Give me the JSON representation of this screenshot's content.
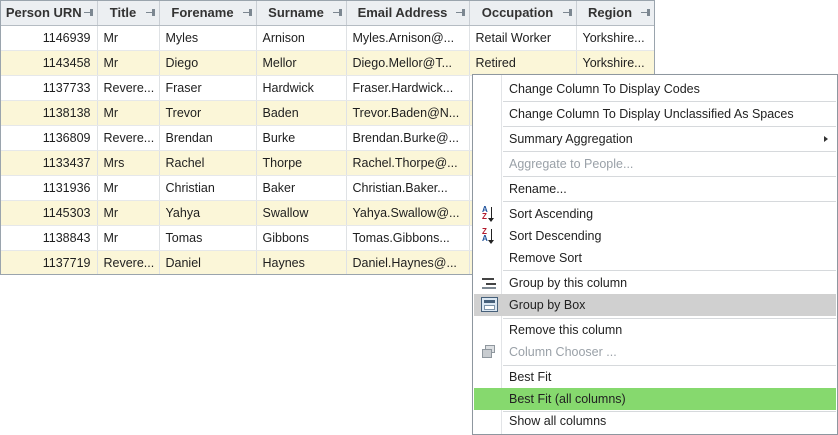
{
  "grid": {
    "columns": [
      {
        "key": "urn",
        "label": "Person URN"
      },
      {
        "key": "title",
        "label": "Title"
      },
      {
        "key": "forename",
        "label": "Forename"
      },
      {
        "key": "surname",
        "label": "Surname"
      },
      {
        "key": "email",
        "label": "Email Address"
      },
      {
        "key": "occupation",
        "label": "Occupation"
      },
      {
        "key": "region",
        "label": "Region"
      }
    ],
    "rows": [
      {
        "urn": "1146939",
        "title": "Mr",
        "forename": "Myles",
        "surname": "Arnison",
        "email": "Myles.Arnison@...",
        "occupation": "Retail Worker",
        "region": "Yorkshire..."
      },
      {
        "urn": "1143458",
        "title": "Mr",
        "forename": "Diego",
        "surname": "Mellor",
        "email": "Diego.Mellor@T...",
        "occupation": "Retired",
        "region": "Yorkshire..."
      },
      {
        "urn": "1137733",
        "title": "Revere...",
        "forename": "Fraser",
        "surname": "Hardwick",
        "email": "Fraser.Hardwick...",
        "occupation": "",
        "region": ""
      },
      {
        "urn": "1138138",
        "title": "Mr",
        "forename": "Trevor",
        "surname": "Baden",
        "email": "Trevor.Baden@N...",
        "occupation": "",
        "region": ""
      },
      {
        "urn": "1136809",
        "title": "Revere...",
        "forename": "Brendan",
        "surname": "Burke",
        "email": "Brendan.Burke@...",
        "occupation": "",
        "region": ""
      },
      {
        "urn": "1133437",
        "title": "Mrs",
        "forename": "Rachel",
        "surname": "Thorpe",
        "email": "Rachel.Thorpe@...",
        "occupation": "",
        "region": ""
      },
      {
        "urn": "1131936",
        "title": "Mr",
        "forename": "Christian",
        "surname": "Baker",
        "email": "Christian.Baker...",
        "occupation": "",
        "region": ""
      },
      {
        "urn": "1145303",
        "title": "Mr",
        "forename": "Yahya",
        "surname": "Swallow",
        "email": "Yahya.Swallow@...",
        "occupation": "",
        "region": ""
      },
      {
        "urn": "1138843",
        "title": "Mr",
        "forename": "Tomas",
        "surname": "Gibbons",
        "email": "Tomas.Gibbons...",
        "occupation": "",
        "region": ""
      },
      {
        "urn": "1137719",
        "title": "Revere...",
        "forename": "Daniel",
        "surname": "Haynes",
        "email": "Daniel.Haynes@...",
        "occupation": "",
        "region": ""
      }
    ]
  },
  "menu": {
    "items": [
      {
        "label": "Change Column To Display Codes",
        "state": "normal"
      },
      {
        "label": "Change Column To Display Unclassified As Spaces",
        "state": "normal"
      },
      {
        "label": "Summary Aggregation",
        "state": "normal",
        "submenu": true
      },
      {
        "label": "Aggregate to People...",
        "state": "disabled"
      },
      {
        "label": "Rename...",
        "state": "normal"
      },
      {
        "label": "Sort Ascending",
        "state": "normal",
        "icon": "sort-ascending-icon"
      },
      {
        "label": "Sort Descending",
        "state": "normal",
        "icon": "sort-descending-icon"
      },
      {
        "label": "Remove Sort",
        "state": "normal"
      },
      {
        "label": "Group by this column",
        "state": "normal",
        "icon": "group-by-column-icon"
      },
      {
        "label": "Group by Box",
        "state": "hover",
        "icon": "group-by-box-icon"
      },
      {
        "label": "Remove this column",
        "state": "normal"
      },
      {
        "label": "Column Chooser ...",
        "state": "disabled",
        "icon": "column-chooser-icon"
      },
      {
        "label": "Best Fit",
        "state": "normal"
      },
      {
        "label": "Best Fit (all columns)",
        "state": "selected"
      },
      {
        "label": "Show all columns",
        "state": "normal"
      }
    ]
  },
  "colors": {
    "alt_row": "#fbf6d8",
    "header_bg": "#eceff2",
    "menu_hover": "#d0d0d0",
    "menu_selected": "#86d96e",
    "disabled_text": "#9aa1a8"
  }
}
